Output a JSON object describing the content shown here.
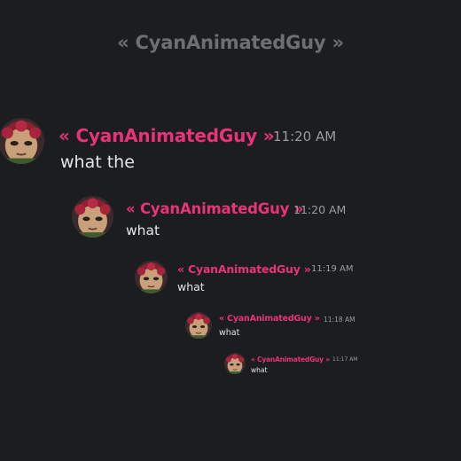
{
  "header": {
    "title": "« CyanAnimatedGuy »"
  },
  "colors": {
    "username": "#e8337a",
    "background": "#1c1d20"
  },
  "messages": [
    {
      "username": "« CyanAnimatedGuy »",
      "time": "11:20 AM",
      "text": "what the",
      "avatar": "avatar-icon"
    },
    {
      "username": "« CyanAnimatedGuy »",
      "time": "11:20 AM",
      "text": "what",
      "avatar": "avatar-icon"
    },
    {
      "username": "« CyanAnimatedGuy »",
      "time": "11:19 AM",
      "text": "what",
      "avatar": "avatar-icon"
    },
    {
      "username": "« CyanAnimatedGuy »",
      "time": "11:18 AM",
      "text": "what",
      "avatar": "avatar-icon"
    },
    {
      "username": "« CyanAnimatedGuy »",
      "time": "11:17 AM",
      "text": "what",
      "avatar": "avatar-icon"
    }
  ]
}
